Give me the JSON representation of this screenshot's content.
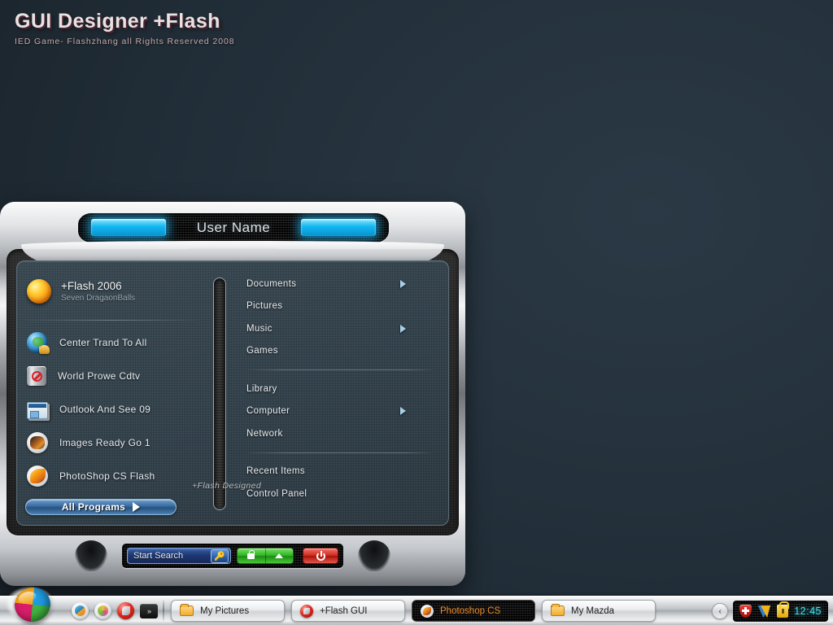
{
  "desktop": {
    "brand_title": "GUI Designer +Flash",
    "brand_subtitle": "IED Game- Flashzhang all Rights Reserved 2008",
    "background_color": "#26333e"
  },
  "start_menu": {
    "header_title": "User Name",
    "watermark": "+Flash Designed",
    "user": {
      "name": "+Flash 2006",
      "subtitle": "Seven DragaonBalls",
      "avatar_icon": "dragonball-icon"
    },
    "left_items": [
      {
        "label": "Center Trand  To All",
        "icon": "globe-icon"
      },
      {
        "label": "World  Prowe  Cdtv",
        "icon": "recycle-bin-icon"
      },
      {
        "label": "Outlook And See 09",
        "icon": "mail-icon"
      },
      {
        "label": "Images Ready Go 1",
        "icon": "imageready-icon"
      },
      {
        "label": "PhotoShop CS Flash",
        "icon": "photoshop-icon"
      }
    ],
    "all_programs_label": "All Programs",
    "right_groups": [
      [
        {
          "label": "Documents",
          "has_arrow": true
        },
        {
          "label": "Pictures",
          "has_arrow": false
        },
        {
          "label": "Music",
          "has_arrow": true
        },
        {
          "label": "Games",
          "has_arrow": false
        }
      ],
      [
        {
          "label": "Library",
          "has_arrow": false
        },
        {
          "label": "Computer",
          "has_arrow": true
        },
        {
          "label": "Network",
          "has_arrow": false
        }
      ],
      [
        {
          "label": "Recent Items",
          "has_arrow": false
        },
        {
          "label": "Control Panel",
          "has_arrow": false
        }
      ]
    ],
    "search": {
      "placeholder": "Start Search",
      "value": "",
      "button_icon": "key-icon"
    },
    "power_controls": {
      "lock_icon": "padlock-icon",
      "eject_icon": "up-arrow-icon",
      "power_icon": "power-icon",
      "lock_color": "#2fb422",
      "power_color": "#cf2a1e"
    }
  },
  "taskbar": {
    "start_button": "start-orb",
    "quick_launch": [
      {
        "name": "quicklaunch-paint-icon"
      },
      {
        "name": "quicklaunch-media-icon"
      },
      {
        "name": "quicklaunch-flash-icon"
      }
    ],
    "overflow_label": "»",
    "buttons": [
      {
        "label": "My  Pictures",
        "icon": "folder-icon",
        "active": false
      },
      {
        "label": "+Flash GUI",
        "icon": "flash-icon",
        "active": false
      },
      {
        "label": "Photoshop CS",
        "icon": "photoshop-icon",
        "active": true
      },
      {
        "label": "My  Mazda",
        "icon": "folder-icon",
        "active": false
      }
    ],
    "tray_expand_label": "‹",
    "tray": [
      {
        "name": "security-shield-icon"
      },
      {
        "name": "messenger-icon"
      },
      {
        "name": "lock-icon"
      }
    ],
    "clock": "12:45",
    "clock_color": "#3fe4f0"
  }
}
